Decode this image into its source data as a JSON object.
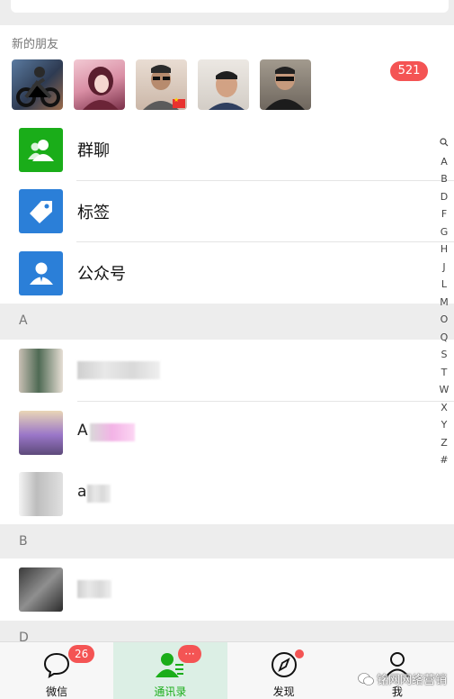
{
  "new_friends": {
    "title": "新的朋友",
    "badge": "521",
    "avatars": [
      "avatar-motorcycle",
      "avatar-anime-girl",
      "avatar-man-glasses",
      "avatar-young-man",
      "avatar-man-sunglasses"
    ]
  },
  "functions": [
    {
      "label": "群聊",
      "icon": "group-chat-icon",
      "color": "#1aad19"
    },
    {
      "label": "标签",
      "icon": "tag-icon",
      "color": "#2b7fd8"
    },
    {
      "label": "公众号",
      "icon": "official-account-icon",
      "color": "#2b7fd8"
    }
  ],
  "sections": {
    "a": "A",
    "b": "B",
    "d": "D"
  },
  "contacts": [
    {
      "name": ""
    },
    {
      "name": "A"
    },
    {
      "name": "a"
    },
    {
      "name": ""
    }
  ],
  "index_bar": [
    "A",
    "B",
    "D",
    "F",
    "G",
    "H",
    "J",
    "L",
    "M",
    "O",
    "Q",
    "S",
    "T",
    "W",
    "X",
    "Y",
    "Z",
    "#"
  ],
  "tabbar": {
    "tabs": [
      {
        "label": "微信",
        "badge": "26"
      },
      {
        "label": "通讯录",
        "badge": "···"
      },
      {
        "label": "发现"
      },
      {
        "label": "我"
      }
    ]
  },
  "watermark": "铭网网络营销",
  "colors": {
    "wechat_green": "#1aad19",
    "badge_red": "#f45454",
    "blue": "#2b7fd8"
  }
}
